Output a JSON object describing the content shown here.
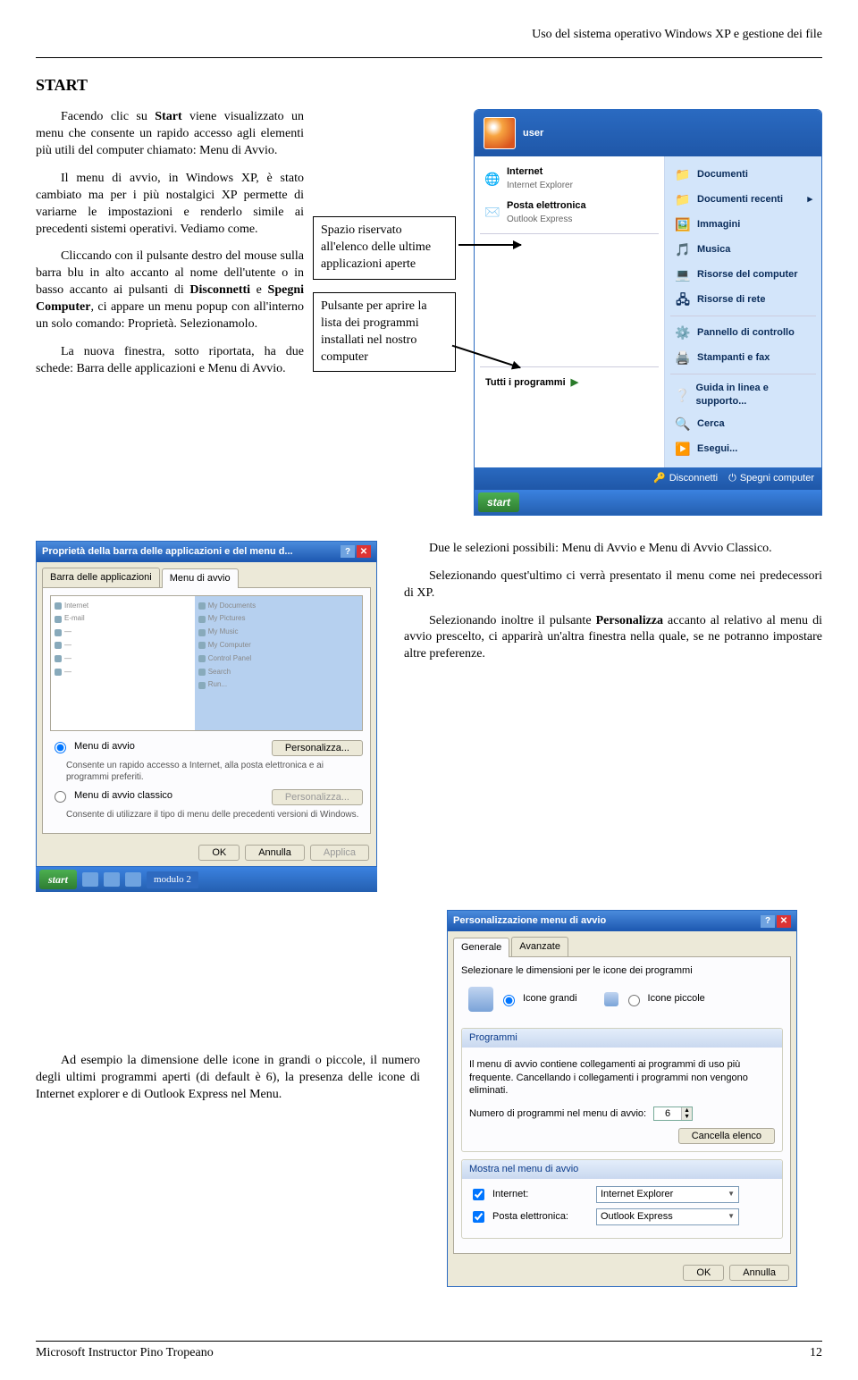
{
  "header_right": "Uso del sistema operativo Windows XP e gestione dei file",
  "h2": "START",
  "para1_a": "Facendo clic su ",
  "para1_b": "Start",
  "para1_c": " viene visualizzato un menu che consente un rapido accesso agli elementi più utili del computer chiamato: Menu di Avvio.",
  "para2": "Il menu di avvio, in Windows XP, è stato cambiato ma per i più nostalgici XP permette di variarne le impostazioni e renderlo simile ai precedenti sistemi operativi. Vediamo come.",
  "para3_a": "Cliccando con il pulsante destro del mouse sulla barra blu in alto accanto al nome dell'utente o in basso accanto ai pulsanti di ",
  "para3_b": "Disconnetti",
  "para3_c": " e ",
  "para3_d": "Spegni Computer",
  "para3_e": ", ci appare un menu popup con all'interno un solo comando: Proprietà. Selezionamolo.",
  "para4": "La nuova finestra, sotto riportata, ha due schede: Barra delle applicazioni e Menu di Avvio.",
  "callout1": "Spazio riservato all'elenco delle ultime applicazioni aperte",
  "callout2": "Pulsante per aprire la lista dei programmi installati nel nostro computer",
  "sm": {
    "user": "user",
    "left": {
      "ie": "Internet",
      "ie_sub": "Internet Explorer",
      "mail": "Posta elettronica",
      "mail_sub": "Outlook Express"
    },
    "allprog": "Tutti i programmi",
    "right": {
      "docs": "Documenti",
      "recent": "Documenti recenti",
      "images": "Immagini",
      "music": "Musica",
      "mycomp": "Risorse del computer",
      "netres": "Risorse di rete",
      "cp": "Pannello di controllo",
      "printers": "Stampanti e fax",
      "help": "Guida in linea e supporto...",
      "search": "Cerca",
      "run": "Esegui..."
    },
    "logoff": "Disconnetti",
    "shutdown": "Spegni computer",
    "startbtn": "start"
  },
  "mp1": "Due le selezioni possibili: Menu di Avvio e Menu di Avvio Classico.",
  "mp2": "Selezionando quest'ultimo ci verrà presentato il menu come nei predecessori di XP.",
  "mp3_a": "Selezionando inoltre il pulsante ",
  "mp3_b": "Personalizza",
  "mp3_c": " accanto al relativo al menu di avvio prescelto, ci apparirà un'altra finestra nella quale, se ne potranno impostare altre preferenze.",
  "dlg1": {
    "title": "Proprietà della barra delle applicazioni e del menu d...",
    "tab1": "Barra delle applicazioni",
    "tab2": "Menu di avvio",
    "r1": "Menu di avvio",
    "r1d": "Consente un rapido accesso a Internet, alla posta elettronica e ai programmi preferiti.",
    "r2": "Menu di avvio classico",
    "r2d": "Consente di utilizzare il tipo di menu delle precedenti versioni di Windows.",
    "pers": "Personalizza...",
    "ok": "OK",
    "cancel": "Annulla",
    "apply": "Applica",
    "tbstart": "start",
    "tbtask": "modulo 2"
  },
  "bp": "Ad esempio la dimensione delle icone in grandi o piccole, il numero degli ultimi programmi aperti (di default è 6), la presenza delle icone di Internet explorer e di Outlook Express nel Menu.",
  "dlg2": {
    "title": "Personalizzazione menu di avvio",
    "tab1": "Generale",
    "tab2": "Avanzate",
    "selsize": "Selezionare le dimensioni per le icone dei programmi",
    "big": "Icone grandi",
    "small": "Icone piccole",
    "g_prog": "Programmi",
    "desc": "Il menu di avvio contiene collegamenti ai programmi di uso più frequente. Cancellando i collegamenti i programmi non vengono eliminati.",
    "numlabel": "Numero di programmi nel menu di avvio:",
    "numval": "6",
    "clear": "Cancella elenco",
    "g_show": "Mostra nel menu di avvio",
    "internet": "Internet:",
    "internet_val": "Internet Explorer",
    "mail": "Posta elettronica:",
    "mail_val": "Outlook Express",
    "ok": "OK",
    "cancel": "Annulla"
  },
  "footer_left": "Microsoft Instructor Pino Tropeano",
  "footer_right": "12"
}
